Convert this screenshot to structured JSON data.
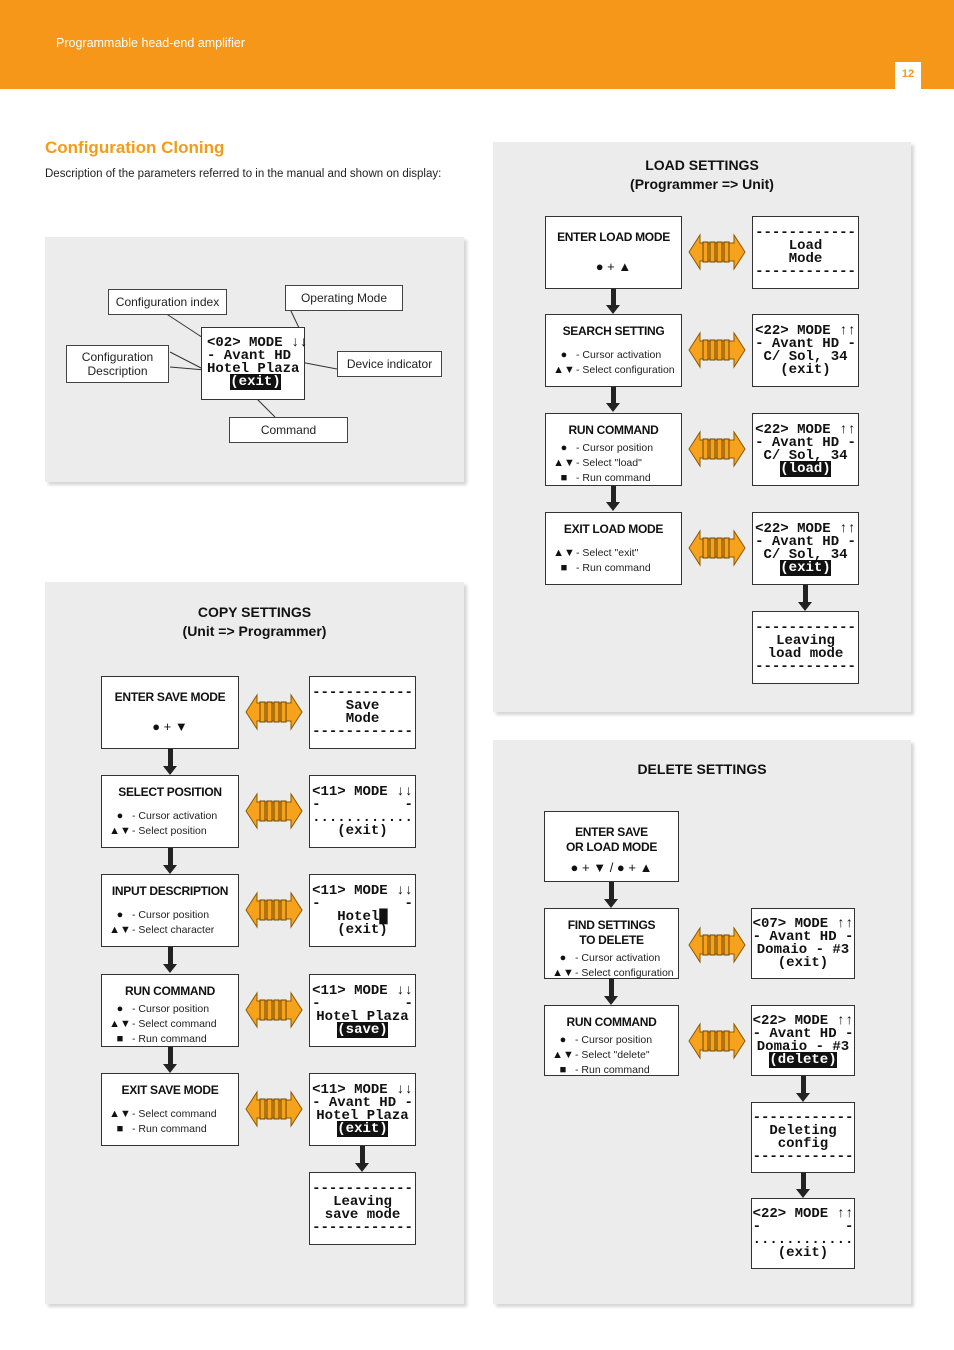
{
  "header": {
    "title": "Programmable head-end amplifier",
    "page_number": "12",
    "accent_color": "#f7971a"
  },
  "section": {
    "title": "Configuration Cloning",
    "intro": "Description of the parameters referred to in the manual and shown on display:"
  },
  "legend": {
    "labels": {
      "config_index": "Configuration index",
      "operating_mode": "Operating Mode",
      "config_description": "Configuration Description",
      "device_indicator": "Device indicator",
      "command": "Command"
    },
    "lcd": [
      "<02> MODE ↓↓",
      "- Avant HD",
      "Hotel Plaza",
      "(exit)"
    ]
  },
  "copy": {
    "title": "COPY SETTINGS",
    "subtitle": "(Unit => Programmer)",
    "steps": [
      {
        "title": "ENTER SAVE MODE",
        "keys": "● + ▼",
        "rows": [],
        "lcd": [
          "------------",
          "Save",
          "Mode",
          "------------"
        ]
      },
      {
        "title": "SELECT POSITION",
        "rows": [
          {
            "sym": "●",
            "text": "- Cursor activation"
          },
          {
            "sym": "▲▼",
            "text": "- Select position"
          }
        ],
        "lcd": [
          "<11> MODE ↓↓",
          "-          -",
          "............",
          "(exit)"
        ]
      },
      {
        "title": "INPUT DESCRIPTION",
        "rows": [
          {
            "sym": "●",
            "text": "- Cursor position"
          },
          {
            "sym": "▲▼",
            "text": "- Select character"
          }
        ],
        "lcd": [
          "<11> MODE ↓↓",
          "-          -",
          "Hotel█",
          "(exit)"
        ]
      },
      {
        "title": "RUN COMMAND",
        "rows": [
          {
            "sym": "●",
            "text": "- Cursor position"
          },
          {
            "sym": "▲▼",
            "text": "- Select command"
          },
          {
            "sym": "■",
            "text": "- Run command"
          }
        ],
        "lcd": [
          "<11> MODE ↓↓",
          "-          -",
          "Hotel Plaza",
          "(save)"
        ]
      },
      {
        "title": "EXIT SAVE MODE",
        "rows": [
          {
            "sym": "▲▼",
            "text": "- Select command"
          },
          {
            "sym": "■",
            "text": "- Run command"
          }
        ],
        "lcd": [
          "<11> MODE ↓↓",
          "- Avant HD -",
          "Hotel Plaza",
          "(exit)"
        ]
      }
    ],
    "final_lcd": [
      "------------",
      "Leaving",
      "save mode",
      "------------"
    ]
  },
  "load": {
    "title": "LOAD SETTINGS",
    "subtitle": "(Programmer => Unit)",
    "steps": [
      {
        "title": "ENTER LOAD MODE",
        "keys": "● + ▲",
        "rows": [],
        "lcd": [
          "------------",
          "Load",
          "Mode",
          "------------"
        ]
      },
      {
        "title": "SEARCH SETTING",
        "rows": [
          {
            "sym": "●",
            "text": "- Cursor activation"
          },
          {
            "sym": "▲▼",
            "text": "- Select configuration"
          }
        ],
        "lcd": [
          "<22> MODE ↑↑",
          "- Avant HD -",
          "C/ Sol, 34",
          "(exit)"
        ]
      },
      {
        "title": "RUN COMMAND",
        "rows": [
          {
            "sym": "●",
            "text": "- Cursor position"
          },
          {
            "sym": "▲▼",
            "text": "- Select \"load\""
          },
          {
            "sym": "■",
            "text": "- Run command"
          }
        ],
        "lcd": [
          "<22> MODE ↑↑",
          "- Avant HD -",
          "C/ Sol, 34",
          "(load)"
        ]
      },
      {
        "title": "EXIT LOAD MODE",
        "rows": [
          {
            "sym": "▲▼",
            "text": "- Select \"exit\""
          },
          {
            "sym": "■",
            "text": "- Run command"
          }
        ],
        "lcd": [
          "<22> MODE ↑↑",
          "- Avant HD -",
          "C/ Sol, 34",
          "(exit)"
        ]
      }
    ],
    "final_lcd": [
      "------------",
      "Leaving",
      "load mode",
      "------------"
    ]
  },
  "delete": {
    "title": "DELETE SETTINGS",
    "steps": [
      {
        "title": "ENTER SAVE OR LOAD MODE",
        "title_lines": [
          "ENTER SAVE",
          "OR LOAD MODE"
        ],
        "keys": "● + ▼ / ● + ▲",
        "rows": []
      },
      {
        "title": "FIND SETTINGS TO DELETE",
        "title_lines": [
          "FIND SETTINGS",
          "TO DELETE"
        ],
        "rows": [
          {
            "sym": "●",
            "text": "- Cursor activation"
          },
          {
            "sym": "▲▼",
            "text": "- Select configuration"
          }
        ],
        "lcd": [
          "<07> MODE ↑↑",
          "- Avant HD -",
          "Domaio - #3",
          "(exit)"
        ]
      },
      {
        "title": "RUN COMMAND",
        "rows": [
          {
            "sym": "●",
            "text": "- Cursor position"
          },
          {
            "sym": "▲▼",
            "text": "- Select \"delete\""
          },
          {
            "sym": "■",
            "text": "- Run command"
          }
        ],
        "lcd": [
          "<22> MODE ↑↑",
          "- Avant HD -",
          "Domaio - #3",
          "(delete)"
        ]
      }
    ],
    "deleting_lcd": [
      "------------",
      "Deleting",
      "config",
      "------------"
    ],
    "final_lcd": [
      "<22> MODE ↑↑",
      "-          -",
      "............",
      "(exit)"
    ]
  }
}
